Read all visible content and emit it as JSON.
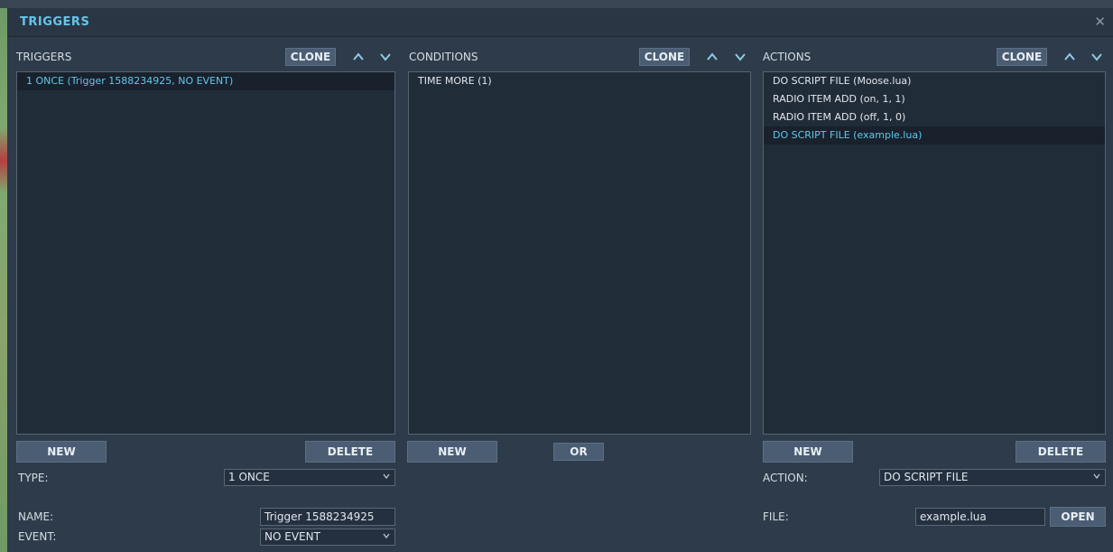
{
  "window": {
    "title": "TRIGGERS",
    "close_glyph": "✕"
  },
  "triggers": {
    "header": "TRIGGERS",
    "clone_label": "CLONE",
    "items": [
      {
        "label": "1 ONCE (Trigger 1588234925, NO EVENT)",
        "selected": true
      }
    ],
    "new_label": "NEW",
    "delete_label": "DELETE",
    "type_label": "TYPE:",
    "type_value": "1 ONCE",
    "name_label": "NAME:",
    "name_value": "Trigger 1588234925",
    "event_label": "EVENT:",
    "event_value": "NO EVENT"
  },
  "conditions": {
    "header": "CONDITIONS",
    "clone_label": "CLONE",
    "items": [
      {
        "label": "TIME MORE (1)",
        "selected": false
      }
    ],
    "new_label": "NEW",
    "or_label": "OR"
  },
  "actions": {
    "header": "ACTIONS",
    "clone_label": "CLONE",
    "items": [
      {
        "label": "DO SCRIPT FILE (Moose.lua)",
        "selected": false
      },
      {
        "label": "RADIO ITEM ADD (on, 1, 1)",
        "selected": false
      },
      {
        "label": "RADIO ITEM ADD (off, 1, 0)",
        "selected": false
      },
      {
        "label": "DO SCRIPT FILE (example.lua)",
        "selected": true
      }
    ],
    "new_label": "NEW",
    "delete_label": "DELETE",
    "action_label": "ACTION:",
    "action_value": "DO SCRIPT FILE",
    "file_label": "FILE:",
    "file_value": "example.lua",
    "open_label": "OPEN"
  },
  "colors": {
    "accent": "#63c6ea",
    "button": "#4a5d73",
    "list_bg": "#212c39",
    "panel_bg": "#2e3b4a"
  }
}
